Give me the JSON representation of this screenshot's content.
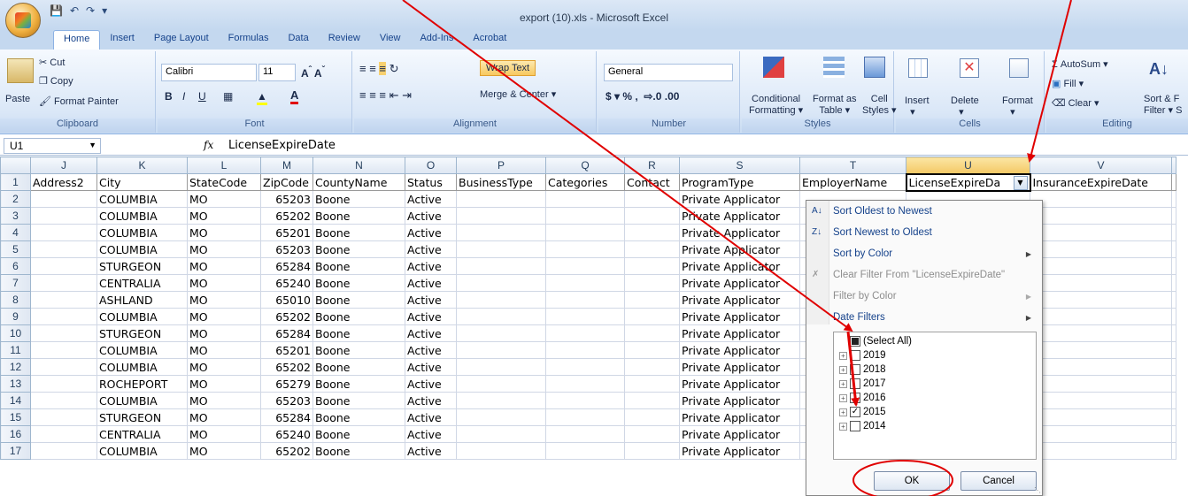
{
  "window": {
    "title": "export (10).xls - Microsoft Excel"
  },
  "ribbon_tabs": [
    "Home",
    "Insert",
    "Page Layout",
    "Formulas",
    "Data",
    "Review",
    "View",
    "Add-Ins",
    "Acrobat"
  ],
  "clipboard": {
    "paste": "Paste",
    "cut": "Cut",
    "copy": "Copy",
    "format_painter": "Format Painter",
    "label": "Clipboard"
  },
  "font": {
    "name": "Calibri",
    "size": "11",
    "label": "Font"
  },
  "alignment": {
    "wrap": "Wrap Text",
    "merge": "Merge & Center",
    "label": "Alignment"
  },
  "number": {
    "format": "General",
    "label": "Number"
  },
  "styles": {
    "cond": "Conditional",
    "cond2": "Formatting",
    "format_as": "Format as",
    "table": "Table",
    "cell": "Cell",
    "cell_styles": "Styles",
    "label": "Styles"
  },
  "cells": {
    "insert": "Insert",
    "delete": "Delete",
    "format": "Format",
    "label": "Cells"
  },
  "editing": {
    "autosum": "AutoSum",
    "fill": "Fill",
    "clear": "Clear",
    "sort": "Sort &",
    "filter": "Filter",
    "label": "Editing"
  },
  "formula_bar": {
    "name_box": "U1",
    "fx": "fx",
    "value": "LicenseExpireDate"
  },
  "columns": [
    "J",
    "K",
    "L",
    "M",
    "N",
    "O",
    "P",
    "Q",
    "R",
    "S",
    "T",
    "U",
    "V"
  ],
  "header_row": [
    "Address2",
    "City",
    "StateCode",
    "ZipCode",
    "CountyName",
    "Status",
    "BusinessType",
    "Categories",
    "Contact",
    "ProgramType",
    "EmployerName",
    "LicenseExpireDa",
    "InsuranceExpireDate"
  ],
  "rows": [
    {
      "n": "2",
      "city": "COLUMBIA",
      "state": "MO",
      "zip": "65203",
      "county": "Boone",
      "status": "Active",
      "program": "Private Applicator"
    },
    {
      "n": "3",
      "city": "COLUMBIA",
      "state": "MO",
      "zip": "65202",
      "county": "Boone",
      "status": "Active",
      "program": "Private Applicator"
    },
    {
      "n": "4",
      "city": "COLUMBIA",
      "state": "MO",
      "zip": "65201",
      "county": "Boone",
      "status": "Active",
      "program": "Private Applicator"
    },
    {
      "n": "5",
      "city": "COLUMBIA",
      "state": "MO",
      "zip": "65203",
      "county": "Boone",
      "status": "Active",
      "program": "Private Applicator"
    },
    {
      "n": "6",
      "city": "STURGEON",
      "state": "MO",
      "zip": "65284",
      "county": "Boone",
      "status": "Active",
      "program": "Private Applicator"
    },
    {
      "n": "7",
      "city": "CENTRALIA",
      "state": "MO",
      "zip": "65240",
      "county": "Boone",
      "status": "Active",
      "program": "Private Applicator"
    },
    {
      "n": "8",
      "city": "ASHLAND",
      "state": "MO",
      "zip": "65010",
      "county": "Boone",
      "status": "Active",
      "program": "Private Applicator"
    },
    {
      "n": "9",
      "city": "COLUMBIA",
      "state": "MO",
      "zip": "65202",
      "county": "Boone",
      "status": "Active",
      "program": "Private Applicator"
    },
    {
      "n": "10",
      "city": "STURGEON",
      "state": "MO",
      "zip": "65284",
      "county": "Boone",
      "status": "Active",
      "program": "Private Applicator"
    },
    {
      "n": "11",
      "city": "COLUMBIA",
      "state": "MO",
      "zip": "65201",
      "county": "Boone",
      "status": "Active",
      "program": "Private Applicator"
    },
    {
      "n": "12",
      "city": "COLUMBIA",
      "state": "MO",
      "zip": "65202",
      "county": "Boone",
      "status": "Active",
      "program": "Private Applicator"
    },
    {
      "n": "13",
      "city": "ROCHEPORT",
      "state": "MO",
      "zip": "65279",
      "county": "Boone",
      "status": "Active",
      "program": "Private Applicator"
    },
    {
      "n": "14",
      "city": "COLUMBIA",
      "state": "MO",
      "zip": "65203",
      "county": "Boone",
      "status": "Active",
      "program": "Private Applicator"
    },
    {
      "n": "15",
      "city": "STURGEON",
      "state": "MO",
      "zip": "65284",
      "county": "Boone",
      "status": "Active",
      "program": "Private Applicator"
    },
    {
      "n": "16",
      "city": "CENTRALIA",
      "state": "MO",
      "zip": "65240",
      "county": "Boone",
      "status": "Active",
      "program": "Private Applicator"
    },
    {
      "n": "17",
      "city": "COLUMBIA",
      "state": "MO",
      "zip": "65202",
      "county": "Boone",
      "status": "Active",
      "program": "Private Applicator"
    }
  ],
  "filter_menu": {
    "sort_old": "Sort Oldest to Newest",
    "sort_new": "Sort Newest to Oldest",
    "sort_color": "Sort by Color",
    "clear": "Clear Filter From \"LicenseExpireDate\"",
    "filter_color": "Filter by Color",
    "date_filters": "Date Filters",
    "items": [
      {
        "label": "(Select All)",
        "state": "partial"
      },
      {
        "label": "2019",
        "state": "unchecked"
      },
      {
        "label": "2018",
        "state": "unchecked"
      },
      {
        "label": "2017",
        "state": "unchecked"
      },
      {
        "label": "2016",
        "state": "unchecked"
      },
      {
        "label": "2015",
        "state": "checked"
      },
      {
        "label": "2014",
        "state": "unchecked"
      }
    ],
    "ok": "OK",
    "cancel": "Cancel"
  },
  "annotation_color": "#e00000"
}
